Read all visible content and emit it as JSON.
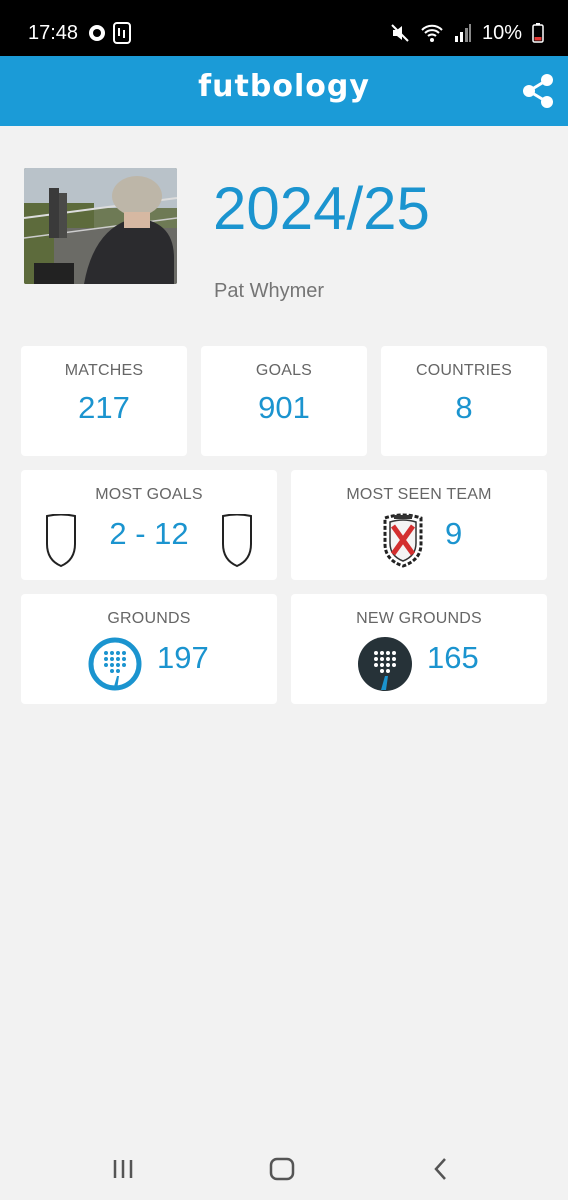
{
  "status_bar": {
    "time": "17:48",
    "battery": "10%"
  },
  "app": {
    "name": "futbology",
    "accent": "#1b9bd7"
  },
  "profile": {
    "season": "2024/25",
    "username": "Pat Whymer"
  },
  "stats": [
    {
      "label": "MATCHES",
      "value": "217"
    },
    {
      "label": "GOALS",
      "value": "901"
    },
    {
      "label": "COUNTRIES",
      "value": "8"
    }
  ],
  "most_goals": {
    "label": "MOST GOALS",
    "score": "2 - 12"
  },
  "most_seen_team": {
    "label": "MOST SEEN TEAM",
    "count": "9"
  },
  "grounds": {
    "label": "GROUNDS",
    "value": "197"
  },
  "new_grounds": {
    "label": "NEW GROUNDS",
    "value": "165"
  }
}
